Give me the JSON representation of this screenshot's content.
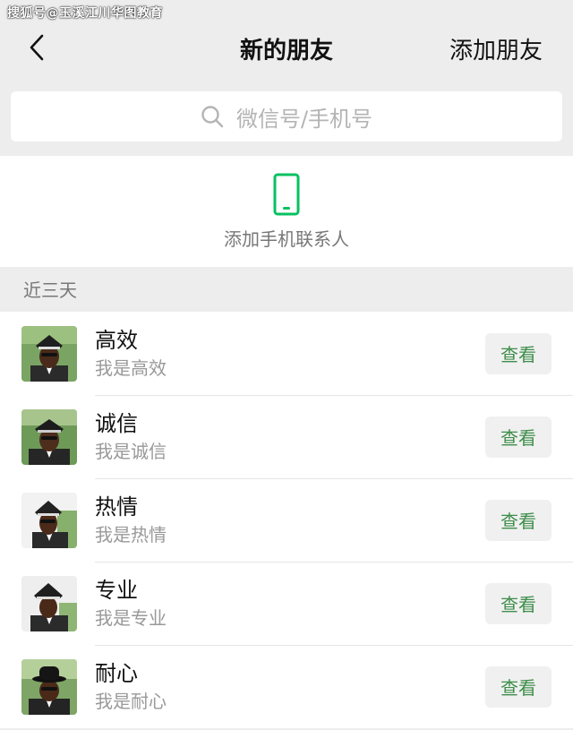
{
  "watermark": "搜狐号@玉溪江川华图教育",
  "header": {
    "back_icon": "chevron-left-icon",
    "title": "新的朋友",
    "action": "添加朋友"
  },
  "search": {
    "icon": "search-icon",
    "placeholder": "微信号/手机号"
  },
  "add_contacts": {
    "icon": "phone-icon",
    "label": "添加手机联系人",
    "icon_color": "#07c160"
  },
  "section": {
    "title": "近三天"
  },
  "friends": [
    {
      "name": "高效",
      "message": "我是高效",
      "button": "查看"
    },
    {
      "name": "诚信",
      "message": "我是诚信",
      "button": "查看"
    },
    {
      "name": "热情",
      "message": "我是热情",
      "button": "查看"
    },
    {
      "name": "专业",
      "message": "我是专业",
      "button": "查看"
    },
    {
      "name": "耐心",
      "message": "我是耐心",
      "button": "查看"
    }
  ],
  "colors": {
    "background": "#ededed",
    "accent_green": "#07c160",
    "button_text": "#3e8e4a"
  }
}
